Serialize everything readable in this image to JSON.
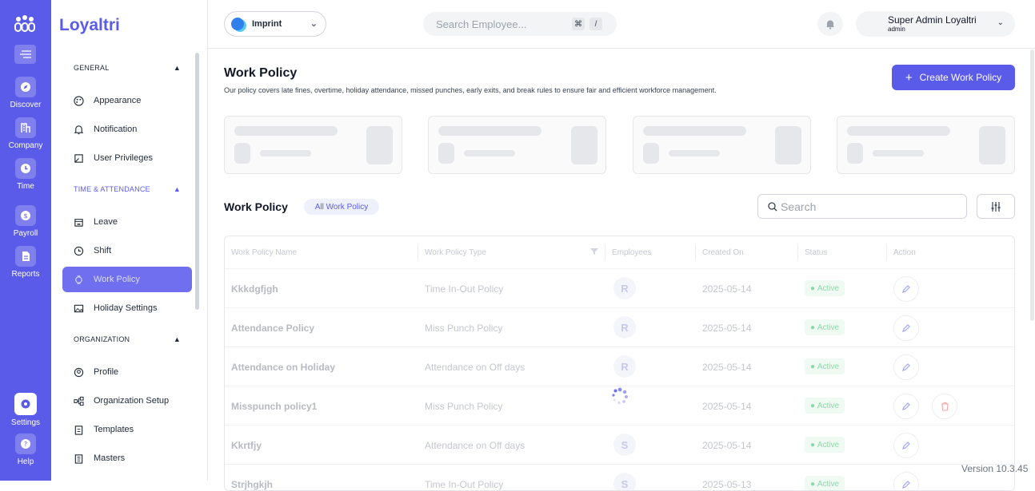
{
  "rail": {
    "items": [
      {
        "label": "Discover",
        "icon": "compass-icon"
      },
      {
        "label": "Company",
        "icon": "building-icon"
      },
      {
        "label": "Time",
        "icon": "clock-icon"
      },
      {
        "label": "Payroll",
        "icon": "dollar-icon"
      },
      {
        "label": "Reports",
        "icon": "document-icon"
      },
      {
        "label": "Settings",
        "icon": "gear-icon"
      },
      {
        "label": "Help",
        "icon": "help-icon"
      }
    ]
  },
  "sidebar": {
    "brand": "Loyaltri",
    "sections": [
      {
        "title": "GENERAL",
        "items": [
          "Appearance",
          "Notification",
          "User Privileges"
        ]
      },
      {
        "title": "TIME & ATTENDANCE",
        "items": [
          "Leave",
          "Shift",
          "Work Policy",
          "Holiday Settings"
        ]
      },
      {
        "title": "ORGANIZATION",
        "items": [
          "Profile",
          "Organization Setup",
          "Templates",
          "Masters"
        ]
      }
    ],
    "active_item": "Work Policy"
  },
  "topbar": {
    "company": "Imprint",
    "search_placeholder": "Search Employee...",
    "kbd_cmd": "⌘",
    "kbd_slash": "/",
    "user_name": "Super Admin Loyaltri",
    "user_role": "admin"
  },
  "page": {
    "title": "Work Policy",
    "description": "Our policy covers late fines, overtime, holiday attendance, missed punches, early exits, and break rules to ensure fair and efficient workforce management.",
    "create_button": "Create Work Policy",
    "create_plus": "+"
  },
  "table_section": {
    "title": "Work Policy",
    "chip": "All Work Policy",
    "search_placeholder": "Search",
    "columns": [
      "Work Policy Name",
      "Work Policy Type",
      "Employees",
      "Created On",
      "Status",
      "Action"
    ],
    "rows": [
      {
        "name": "Kkkdgfjgh",
        "type": "Time In-Out Policy",
        "avatar": "R",
        "created": "2025-05-14",
        "status": "Active"
      },
      {
        "name": "Attendance Policy",
        "type": "Miss Punch Policy",
        "avatar": "R",
        "created": "2025-05-14",
        "status": "Active"
      },
      {
        "name": "Attendance on Holiday",
        "type": "Attendance on Off days",
        "avatar": "R",
        "created": "2025-05-14",
        "status": "Active"
      },
      {
        "name": "Misspunch policy1",
        "type": "Miss Punch Policy",
        "avatar": "",
        "created": "2025-05-14",
        "status": "Active"
      },
      {
        "name": "Kkrtfjy",
        "type": "Attendance on Off days",
        "avatar": "S",
        "created": "2025-05-14",
        "status": "Active"
      },
      {
        "name": "Strjhgkjh",
        "type": "Time In-Out Policy",
        "avatar": "S",
        "created": "2025-05-13",
        "status": "Active"
      }
    ]
  },
  "footer": {
    "version": "Version 10.3.45"
  },
  "colors": {
    "accent": "#5b5bea",
    "active_status": "#8ed8a8",
    "delete": "#f3a6a6"
  }
}
